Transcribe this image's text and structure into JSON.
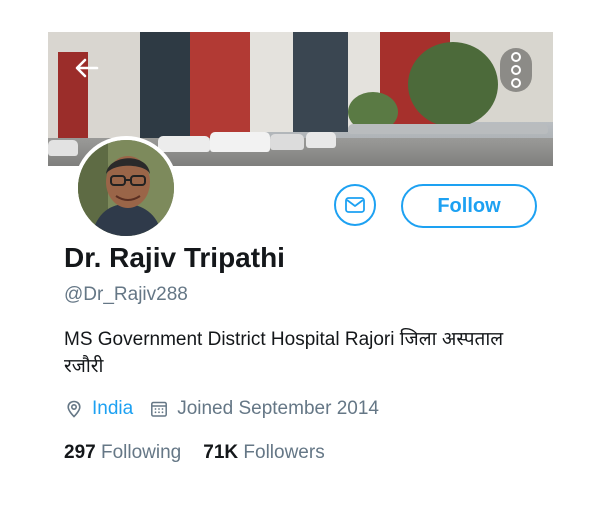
{
  "header": {
    "back_icon": "arrow-left-icon",
    "more_icon": "more-vertical-icon"
  },
  "actions": {
    "message_icon": "envelope-icon",
    "follow_label": "Follow"
  },
  "profile": {
    "name": "Dr. Rajiv Tripathi",
    "handle": "@Dr_Rajiv288",
    "bio": "MS Government District Hospital Rajori जिला अस्पताल रजौरी",
    "location": "India",
    "joined": "Joined September 2014"
  },
  "stats": {
    "following_count": "297",
    "following_label": "Following",
    "followers_count": "71K",
    "followers_label": "Followers"
  },
  "colors": {
    "accent": "#1da1f2",
    "primary_text": "#14171a",
    "secondary_text": "#657786"
  }
}
